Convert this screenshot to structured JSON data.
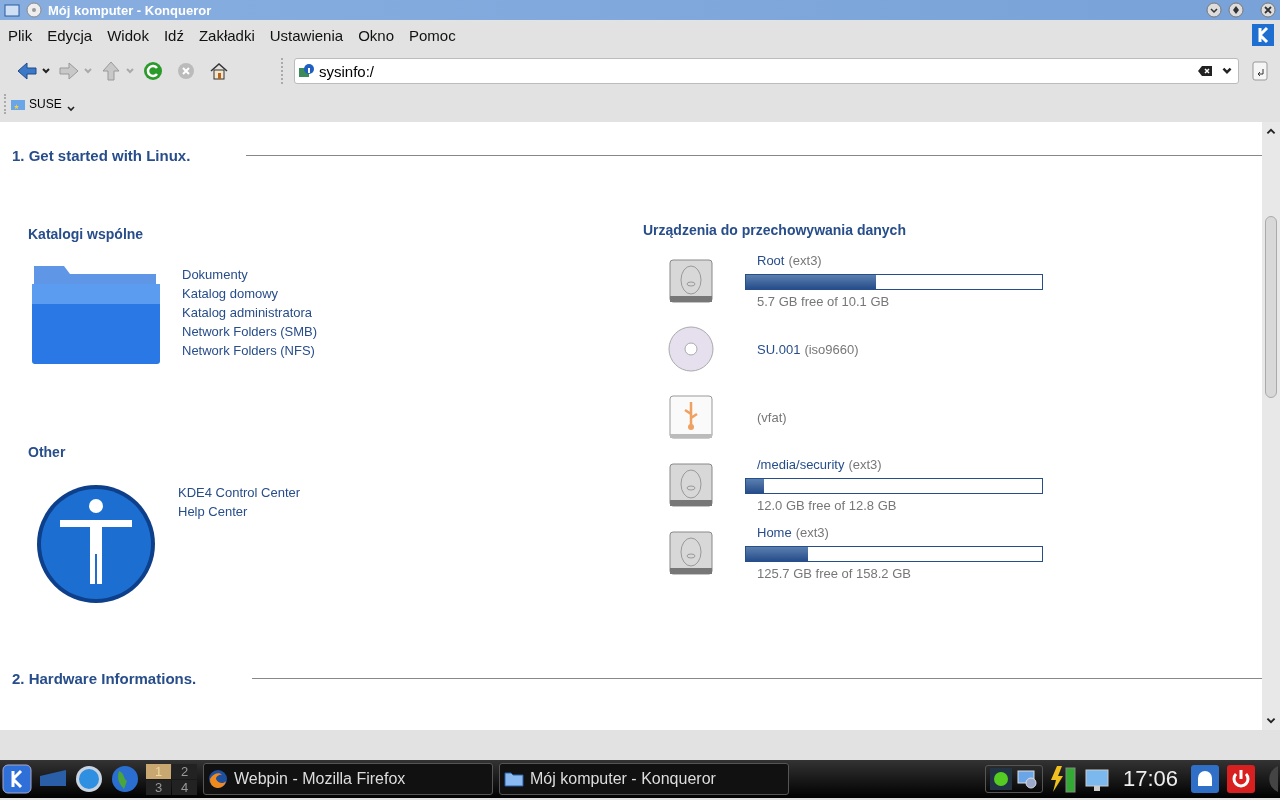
{
  "window": {
    "title": "Mój komputer - Konqueror"
  },
  "menu": [
    "Plik",
    "Edycja",
    "Widok",
    "Idź",
    "Zakładki",
    "Ustawienia",
    "Okno",
    "Pomoc"
  ],
  "location": {
    "value": "sysinfo:/"
  },
  "bookmarks": [
    "SUSE"
  ],
  "sections": [
    {
      "title": "1. Get started with Linux."
    },
    {
      "title": "2. Hardware Informations."
    }
  ],
  "groups": [
    {
      "title": "Katalogi wspólne",
      "kind": "folder",
      "links": [
        "Dokumenty",
        "Katalog domowy",
        "Katalog administratora",
        "Network Folders (SMB)",
        "Network Folders (NFS)"
      ]
    },
    {
      "title": "Other",
      "kind": "help",
      "links": [
        "KDE4 Control Center",
        "Help Center"
      ]
    }
  ],
  "storage": {
    "title": "Urządzenia do przechowywania danych",
    "devices": [
      {
        "kind": "disk",
        "name": "Root",
        "fs": "(ext3)",
        "level": 0.44,
        "free": "5.7 GB free of 10.1 GB"
      },
      {
        "kind": "cd",
        "name": "SU.001",
        "fs": "(iso9660)"
      },
      {
        "kind": "usb",
        "fs": "(vfat)"
      },
      {
        "kind": "disk",
        "name": "/media/security",
        "fs": "(ext3)",
        "level": 0.06,
        "free": "12.0 GB free of 12.8 GB"
      },
      {
        "kind": "disk",
        "name": "Home",
        "fs": "(ext3)",
        "level": 0.21,
        "free": "125.7 GB free of 158.2 GB"
      }
    ]
  },
  "taskbar": {
    "pager": [
      {
        "label": "1",
        "selected": true
      },
      {
        "label": "2",
        "selected": false
      },
      {
        "label": "3",
        "selected": false
      },
      {
        "label": "4",
        "selected": false
      }
    ],
    "tasks": [
      {
        "label": "Webpin - Mozilla Firefox",
        "kind": "firefox"
      },
      {
        "label": "Mój komputer - Konqueror",
        "kind": "folder"
      }
    ],
    "clock": "17:06"
  }
}
